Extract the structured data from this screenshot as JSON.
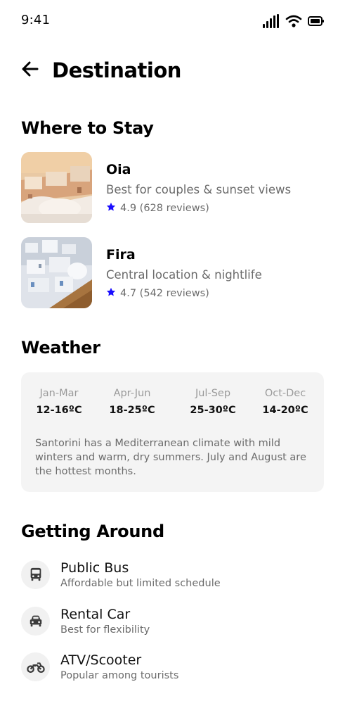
{
  "status_bar": {
    "time": "9:41",
    "icons": [
      "signal-icon",
      "wifi-icon",
      "battery-icon"
    ]
  },
  "header": {
    "back_icon": "arrow-left-icon",
    "title": "Destination"
  },
  "where_to_stay": {
    "title": "Where to Stay",
    "items": [
      {
        "name": "Oia",
        "description": "Best for couples & sunset views",
        "rating": "4.9",
        "reviews": "(628 reviews)"
      },
      {
        "name": "Fira",
        "description": "Central location & nightlife",
        "rating": "4.7",
        "reviews": "(542 reviews)"
      }
    ]
  },
  "weather": {
    "title": "Weather",
    "seasons": [
      {
        "label": "Jan-Mar",
        "temp": "12-16ºC"
      },
      {
        "label": "Apr-Jun",
        "temp": "18-25ºC"
      },
      {
        "label": "Jul-Sep",
        "temp": "25-30ºC"
      },
      {
        "label": "Oct-Dec",
        "temp": "14-20ºC"
      }
    ],
    "note": "Santorini has a Mediterranean climate with mild winters and warm, dry summers. July and August are the hottest months."
  },
  "getting_around": {
    "title": "Getting Around",
    "items": [
      {
        "icon": "bus-icon",
        "name": "Public Bus",
        "description": "Affordable but limited schedule"
      },
      {
        "icon": "car-icon",
        "name": "Rental Car",
        "description": "Best for flexibility"
      },
      {
        "icon": "motorcycle-icon",
        "name": "ATV/Scooter",
        "description": "Popular among tourists"
      }
    ]
  },
  "colors": {
    "star": "#1a0dff",
    "muted_text": "#6b6b6b",
    "card_bg": "#f4f4f4"
  }
}
